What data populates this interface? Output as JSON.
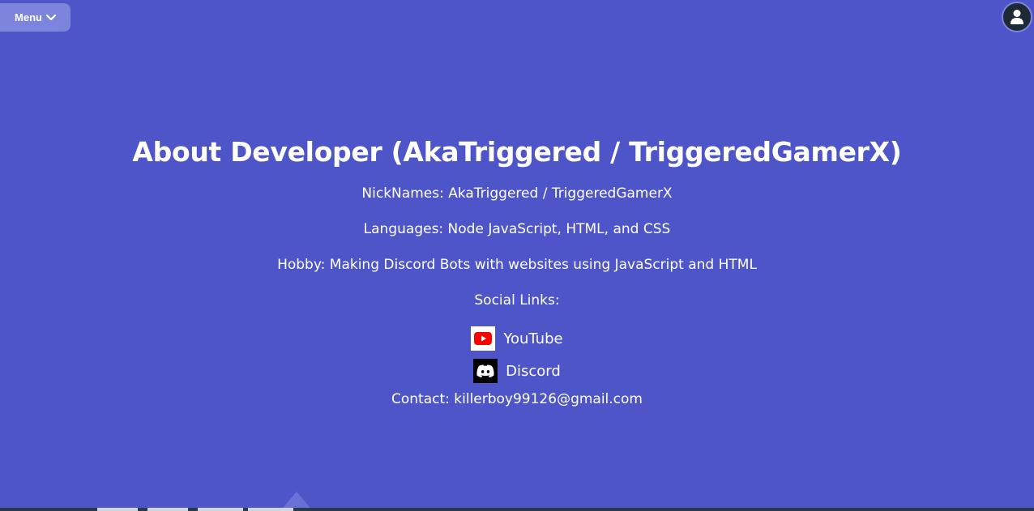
{
  "header": {
    "menu_label": "Menu",
    "menu_icon": "chevron-down-icon",
    "avatar_icon": "user-icon"
  },
  "main": {
    "title": "About Developer (AkaTriggered / TriggeredGamerX)",
    "nicknames": "NickNames: AkaTriggered / TriggeredGamerX",
    "languages": "Languages: Node JavaScript, HTML, and CSS",
    "hobby": "Hobby: Making Discord Bots with websites using JavaScript and HTML",
    "social_heading": "Social Links:",
    "social_links": [
      {
        "label": "YouTube",
        "icon": "youtube-icon"
      },
      {
        "label": "Discord",
        "icon": "discord-icon"
      }
    ],
    "contact": "Contact: killerboy99126@gmail.com"
  },
  "colors": {
    "background": "#4e55c9",
    "menu_button": "#7c84dc",
    "text": "#ffffff",
    "youtube_red": "#ff0000"
  }
}
